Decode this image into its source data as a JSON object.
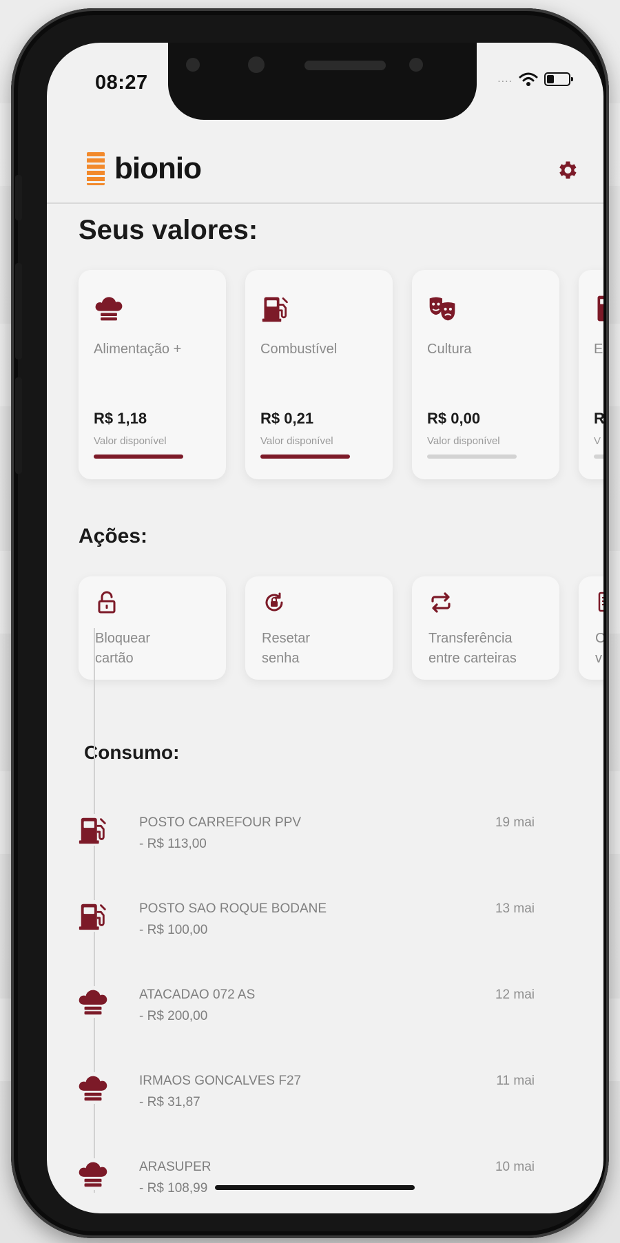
{
  "status_bar": {
    "time": "08:27",
    "signal": "...."
  },
  "header": {
    "logo_text": "bionio",
    "logo_color": "#f2892b",
    "settings_icon": "gear-icon"
  },
  "accent_color": "#7c1a28",
  "values_section": {
    "title": "Seus valores:",
    "cards": [
      {
        "icon": "chef-hat-icon",
        "name": "Alimentação +",
        "amount": "R$ 1,18",
        "sub": "Valor disponível",
        "fill": 1.0
      },
      {
        "icon": "fuel-pump-icon",
        "name": "Combustível",
        "amount": "R$ 0,21",
        "sub": "Valor disponível",
        "fill": 1.0
      },
      {
        "icon": "theater-masks-icon",
        "name": "Cultura",
        "amount": "R$ 0,00",
        "sub": "Valor disponível",
        "fill": 0.0
      },
      {
        "icon": "card-icon",
        "name": "E",
        "amount": "R",
        "sub": "V",
        "fill": 0.0
      }
    ]
  },
  "actions_section": {
    "title": "Ações:",
    "items": [
      {
        "icon": "unlock-icon",
        "label": "Bloquear\ncartão"
      },
      {
        "icon": "reset-password-icon",
        "label": "Resetar\nsenha"
      },
      {
        "icon": "transfer-icon",
        "label": "Transferência\nentre carteiras"
      },
      {
        "icon": "document-icon",
        "label": "C\nv"
      }
    ]
  },
  "consumption_section": {
    "title": "Consumo:",
    "items": [
      {
        "icon": "fuel-pump-icon",
        "merchant": "POSTO CARREFOUR PPV",
        "amount": "- R$ 113,00",
        "date": "19 mai"
      },
      {
        "icon": "fuel-pump-icon",
        "merchant": "POSTO SAO ROQUE BODANE",
        "amount": "- R$ 100,00",
        "date": "13 mai"
      },
      {
        "icon": "chef-hat-icon",
        "merchant": "ATACADAO 072 AS",
        "amount": "- R$ 200,00",
        "date": "12 mai"
      },
      {
        "icon": "chef-hat-icon",
        "merchant": "IRMAOS GONCALVES F27",
        "amount": "- R$ 31,87",
        "date": "11 mai"
      },
      {
        "icon": "chef-hat-icon",
        "merchant": "ARASUPER",
        "amount": "- R$ 108,99",
        "date": "10 mai"
      }
    ]
  }
}
